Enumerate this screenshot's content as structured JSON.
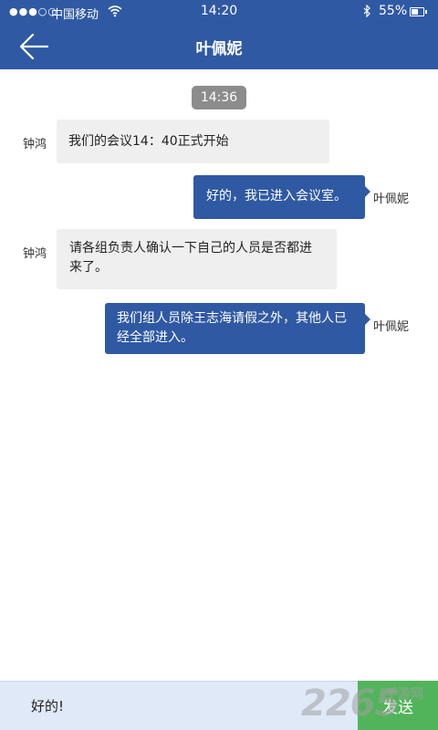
{
  "status_bar": {
    "signal": "●●●○○",
    "carrier": "中国移动",
    "time": "14:20",
    "battery_percent": "55%",
    "battery_level": 0.55,
    "icons": [
      "wifi-icon",
      "bluetooth-icon",
      "battery-icon"
    ]
  },
  "header": {
    "title": "叶佩妮",
    "back_icon": "arrow-left-icon"
  },
  "chat": {
    "time_badge": "14:36",
    "messages": [
      {
        "sender": "钟鸿",
        "text": "我们的会议14：40正式开始",
        "direction": "incoming"
      },
      {
        "sender": "叶佩妮",
        "text": "好的，我已进入会议室。",
        "direction": "outgoing"
      },
      {
        "sender": "钟鸿",
        "text": "请各组负责人确认一下自己的人员是否都进来了。",
        "direction": "incoming"
      },
      {
        "sender": "叶佩妮",
        "text": "我们组人员除王志海请假之外，其他人已经全部进入。",
        "direction": "outgoing"
      }
    ]
  },
  "input_bar": {
    "value": "好的!",
    "send_label": "发送"
  },
  "colors": {
    "header_blue": "#2f59a3",
    "outgoing_bubble": "#2f59a3",
    "incoming_bubble": "#efefef",
    "send_button": "#52b45a",
    "input_bar": "#dfe9f8"
  },
  "watermark": {
    "digits": "2265",
    "text": "手游网"
  }
}
